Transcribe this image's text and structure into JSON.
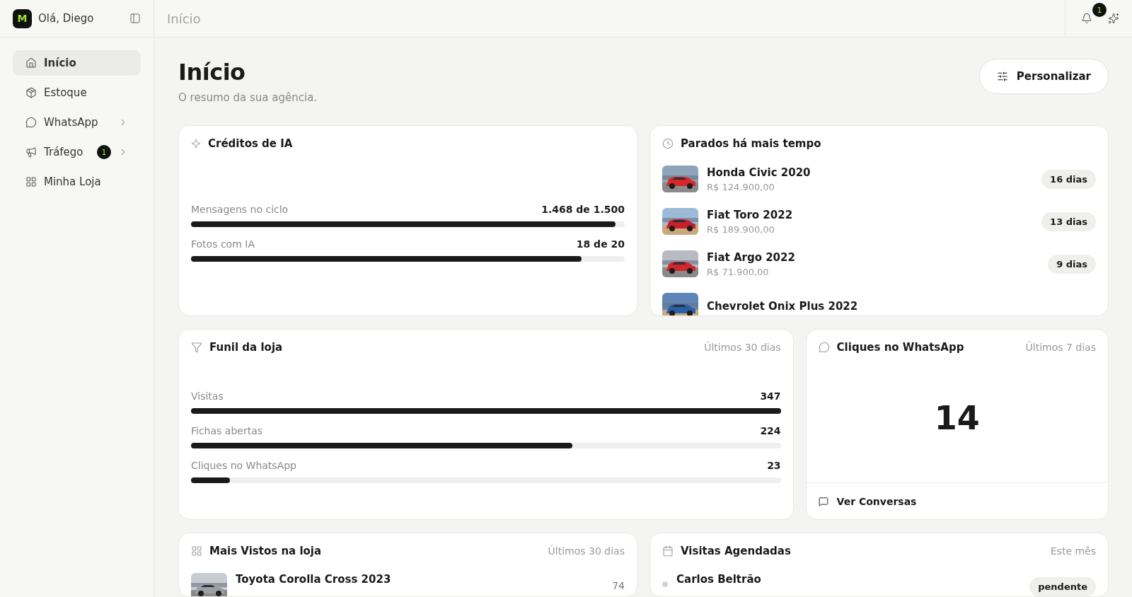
{
  "sidebar": {
    "logo": "M",
    "greeting": "Olá, Diego",
    "items": [
      {
        "label": "Início",
        "selected": true,
        "expandable": false
      },
      {
        "label": "Estoque",
        "selected": false,
        "expandable": false
      },
      {
        "label": "WhatsApp",
        "selected": false,
        "expandable": true
      },
      {
        "label": "Tráfego",
        "selected": false,
        "expandable": true,
        "badge": "1"
      },
      {
        "label": "Minha Loja",
        "selected": false,
        "expandable": false
      }
    ]
  },
  "topbar": {
    "breadcrumb": "Início",
    "notifications": "1"
  },
  "page": {
    "title": "Início",
    "subtitle": "O resumo da sua agência.",
    "customize_button": "Personalizar"
  },
  "credits": {
    "title": "Créditos de IA",
    "meters": [
      {
        "label": "Mensagens no ciclo",
        "value": "1.468 de 1.500",
        "level": 0.979
      },
      {
        "label": "Fotos com IA",
        "value": "18 de 20",
        "level": 0.9
      }
    ]
  },
  "stale": {
    "title": "Parados há mais tempo",
    "cars": [
      {
        "name": "Honda Civic 2020",
        "price": "R$ 124.900,00",
        "days": "16 dias"
      },
      {
        "name": "Fiat Toro 2022",
        "price": "R$ 189.900,00",
        "days": "13 dias"
      },
      {
        "name": "Fiat Argo 2022",
        "price": "R$ 71.900,00",
        "days": "9 dias"
      },
      {
        "name": "Chevrolet Onix Plus 2022"
      }
    ]
  },
  "funnel": {
    "title": "Funil da loja",
    "period": "Últimos 30 dias",
    "meters": [
      {
        "label": "Visitas",
        "value": "347",
        "level": 1
      },
      {
        "label": "Fichas abertas",
        "value": "224",
        "level": 0.646
      },
      {
        "label": "Cliques no WhatsApp",
        "value": "23",
        "level": 0.066
      }
    ]
  },
  "whatsapp": {
    "title": "Cliques no WhatsApp",
    "period": "Últimos 7 dias",
    "count": "14",
    "link": "Ver Conversas"
  },
  "most_viewed": {
    "title": "Mais Vistos na loja",
    "period": "Últimos 30 dias",
    "items": [
      {
        "name": "Toyota Corolla Cross 2023",
        "count": "74"
      }
    ]
  },
  "visits": {
    "title": "Visitas Agendadas",
    "period": "Este mês",
    "items": [
      {
        "name": "Carlos Beltrão",
        "status": "pendente"
      }
    ]
  }
}
